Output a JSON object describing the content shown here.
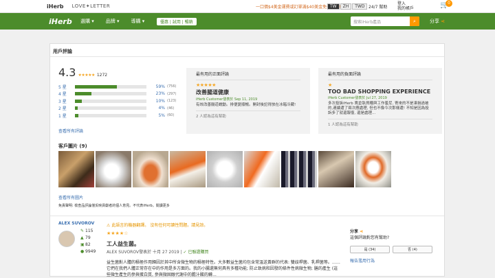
{
  "topbar": {
    "brand": "iHerb",
    "brand2": "LOVE✦LETTER",
    "promo": "一口價$4美金運費或訂單滿$40美金免費運送!",
    "languages": [
      "TW",
      "ZH",
      "TWD"
    ],
    "help": "24/7 幫助",
    "login": "登入",
    "account": "我的帳戶",
    "cart_count": "0"
  },
  "nav": {
    "logo": "iHerb",
    "menu": [
      "選購 ▾",
      "品牌 ▾",
      "導購 ▾"
    ],
    "quick": "優惠 | 試用 | 暢銷",
    "search_placeholder": "搜索iHerb產品",
    "share": "分享"
  },
  "reviews": {
    "heading": "用戶評論",
    "score": "4.3",
    "stars": "★★★★★",
    "count": "1272",
    "distribution": [
      {
        "label": "5 星",
        "pct": "59%",
        "n": "(756)",
        "value": 59
      },
      {
        "label": "4 星",
        "pct": "23%",
        "n": "(297)",
        "value": 23
      },
      {
        "label": "3 星",
        "pct": "10%",
        "n": "(123)",
        "value": 10
      },
      {
        "label": "2 星",
        "pct": "4%",
        "n": "(46)",
        "value": 4
      },
      {
        "label": "1 星",
        "pct": "5%",
        "n": "(60)",
        "value": 5
      }
    ],
    "all_reviews": "查看所有評論",
    "positive": {
      "heading": "最有用的正面評論",
      "stars": "★★★★★",
      "title": "改善腸道健康",
      "meta": "iHerb Customer發表於 Sep 11, 2019",
      "body": "有效改善腸道蠕動。排便變順暢。開封後記得放在冰箱冷藏!",
      "helpful": "2 人認為這有幫助"
    },
    "negative": {
      "heading": "最有用的負面評論",
      "stars": "★",
      "title": "TOO BAD SHOPPING EXPERIENCE IN IHE...",
      "meta": "iHerb Customer發表於 Jul 27, 2019",
      "body": "多次投訴iHerb 賣倉執貨糟與工作羞尼, 寄來的不是凍損過被的,連續遭了兩次應處理, 但也不像今次那樣遭! 不知是因為投訴多了就還報復, 還是處理...",
      "helpful": "1 人認為這有幫助"
    },
    "photos_heading": "客戶圖片 (9)",
    "all_photos": "查看所有圖片",
    "disclaimer": "免責聲明: 檢查品評論僅反映貢獻者的個人意見。不代表iHerb。閱讀更多"
  },
  "review": {
    "author": "ALEX SUVOROV",
    "warning": "⚠ 此語言的機器翻譯。 沒有任何可讀性問題。請見諒。",
    "stats": [
      "115",
      "79",
      "82",
      "9949"
    ],
    "stars": "★★★★☆",
    "title": "工人益生菌。",
    "meta": "ALEX SUVOROV發表於 十月 27 2019 |",
    "verified": "✓ 已驗證購買",
    "body": "益生菌對人體的積極作用歸因於其中所含微生物的積極特性。大多數益生菌均包含常溫送黃群的代表: 雙歧桿菌、乳桿菌等。……它們在我們人體正常存在中的作用是多方面的。我的小腸還無何具有多種功能; 防止致病和因發的條件性病微生物; 膳的產生 (這些微生產生的參與蛋白質, 參與微固醇代謝中的膽汁酸的轉…",
    "share": "分享",
    "helpful_q": "這個評論對您有幫助?",
    "yes": "是 (34)",
    "no": "否 (4)",
    "report": "報告濫用行為"
  }
}
